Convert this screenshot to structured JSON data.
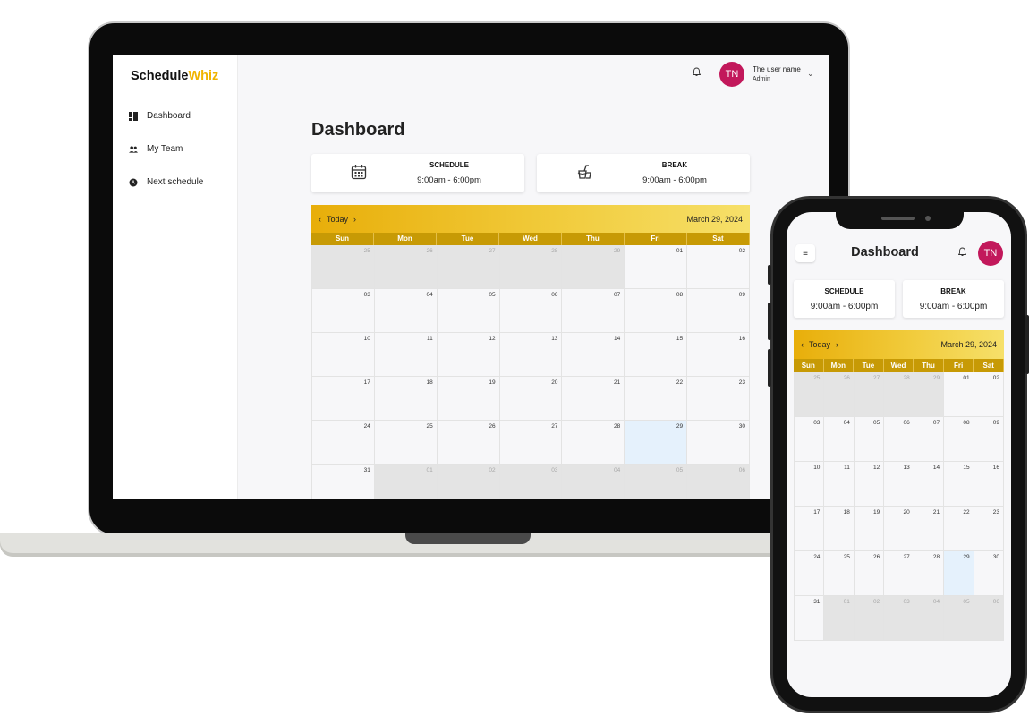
{
  "app": {
    "logo_part1": "Schedule",
    "logo_part2": "Whiz",
    "colors": {
      "accent": "#f0b400",
      "avatar": "#c2185b",
      "calendar_header": "#c79a05",
      "today": "#e5f1fc"
    }
  },
  "sidebar": {
    "items": [
      {
        "label": "Dashboard",
        "icon": "dashboard-icon"
      },
      {
        "label": "My Team",
        "icon": "team-icon"
      },
      {
        "label": "Next schedule",
        "icon": "clock-icon"
      }
    ]
  },
  "header": {
    "avatar_initials": "TN",
    "user_name": "The user name",
    "user_role": "Admin"
  },
  "main": {
    "title": "Dashboard",
    "cards": [
      {
        "label": "SCHEDULE",
        "time": "9:00am - 6:00pm",
        "icon": "calendar-icon"
      },
      {
        "label": "BREAK",
        "time": "9:00am - 6:00pm",
        "icon": "food-icon"
      }
    ]
  },
  "calendar": {
    "today_label": "Today",
    "current_date": "March 29, 2024",
    "weekdays": [
      "Sun",
      "Mon",
      "Tue",
      "Wed",
      "Thu",
      "Fri",
      "Sat"
    ],
    "days": [
      {
        "d": "25",
        "muted": true
      },
      {
        "d": "26",
        "muted": true
      },
      {
        "d": "27",
        "muted": true
      },
      {
        "d": "28",
        "muted": true
      },
      {
        "d": "29",
        "muted": true
      },
      {
        "d": "01"
      },
      {
        "d": "02"
      },
      {
        "d": "03"
      },
      {
        "d": "04"
      },
      {
        "d": "05"
      },
      {
        "d": "06"
      },
      {
        "d": "07"
      },
      {
        "d": "08"
      },
      {
        "d": "09"
      },
      {
        "d": "10"
      },
      {
        "d": "11"
      },
      {
        "d": "12"
      },
      {
        "d": "13"
      },
      {
        "d": "14"
      },
      {
        "d": "15"
      },
      {
        "d": "16"
      },
      {
        "d": "17"
      },
      {
        "d": "18"
      },
      {
        "d": "19"
      },
      {
        "d": "20"
      },
      {
        "d": "21"
      },
      {
        "d": "22"
      },
      {
        "d": "23"
      },
      {
        "d": "24"
      },
      {
        "d": "25"
      },
      {
        "d": "26"
      },
      {
        "d": "27"
      },
      {
        "d": "28"
      },
      {
        "d": "29",
        "today": true
      },
      {
        "d": "30"
      },
      {
        "d": "31"
      },
      {
        "d": "01",
        "muted": true
      },
      {
        "d": "02",
        "muted": true
      },
      {
        "d": "03",
        "muted": true
      },
      {
        "d": "04",
        "muted": true
      },
      {
        "d": "05",
        "muted": true
      },
      {
        "d": "06",
        "muted": true
      }
    ]
  }
}
